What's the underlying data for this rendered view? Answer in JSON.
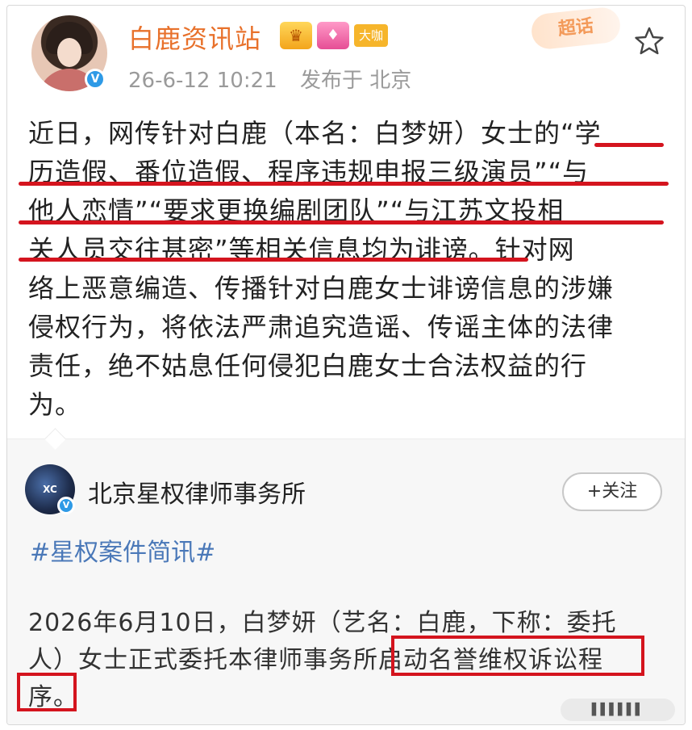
{
  "post": {
    "username": "白鹿资讯站",
    "badge_dakai": "大咖",
    "chaohua_label": "超话",
    "time": "26-6-12 10:21",
    "location": "发布于 北京",
    "text_line1": "近日，网传针对白鹿（本名：白梦妍）女士的“学",
    "text_line2": "历造假、番位造假、程序违规申报三级演员”“与",
    "text_line3": "他人恋情”“要求更换编剧团队”“与江苏文投相",
    "text_line4": "关人员交往甚密”等相关信息均为诽谤。针对网",
    "text_line5": "络上恶意编造、传播针对白鹿女士诽谤信息的涉嫌",
    "text_line6": "侵权行为，将依法严肃追究造谣、传谣主体的法律",
    "text_line7": "责任，绝不姑息任何侵犯白鹿女士合法权益的行",
    "text_line8": "为。"
  },
  "repost": {
    "avatar_text": "XC",
    "name": "北京星权律师事务所",
    "follow_label": "+关注",
    "hashtag": "#星权案件简讯#",
    "text_line1": "2026年6月10日，白梦妍（艺名：白鹿，下称：委托",
    "text_line2": "人）女士正式委托本律师事务所启动名誉维权诉讼程",
    "text_line3": "序。"
  },
  "colors": {
    "username": "#e8712b",
    "highlight_red": "#d4141e",
    "hashtag_blue": "#4a78b8",
    "verified_blue": "#2e9ae6"
  },
  "icons": [
    "verified-icon",
    "crown-badge-icon",
    "gem-badge-icon",
    "star-icon"
  ]
}
